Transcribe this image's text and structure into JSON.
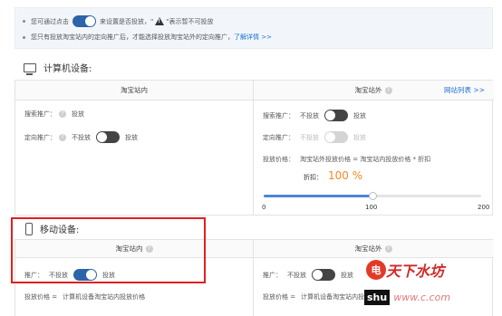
{
  "notice": {
    "line1_prefix": "您可通过点击",
    "line1_mid": "来设置是否投放，\"",
    "line1_suffix": "\"表示暂不可投放",
    "line2_text": "您只有投放淘宝站内的定向推广后，才能选择投放淘宝站外的定向推广，",
    "line2_link": "了解详情 >>"
  },
  "computer": {
    "title": "计算机设备:",
    "inside_header": "淘宝站内",
    "outside_header": "淘宝站外",
    "site_list_link": "网站列表 >>",
    "inside": {
      "search_label": "搜索推广：",
      "search_value": "投放",
      "targeted_label": "定向推广：",
      "targeted_off": "不投放",
      "targeted_on": "投放"
    },
    "outside": {
      "search_label": "搜索推广：",
      "search_off": "不投放",
      "search_on": "投放",
      "targeted_label": "定向推广：",
      "targeted_off": "不投放",
      "targeted_on": "投放",
      "price_label": "投放价格：",
      "price_formula": "淘宝站外投放价格 = 淘宝站内投放价格 * 折扣",
      "discount_label": "折扣：",
      "discount_value": "100 %",
      "slider_value": 100,
      "slider_min": "0",
      "slider_mid": "100",
      "slider_max": "200"
    }
  },
  "mobile": {
    "title": "移动设备:",
    "inside_header": "淘宝站内",
    "outside_header": "淘宝站外",
    "inside": {
      "promo_label": "推广：",
      "promo_off": "不投放",
      "promo_on": "投放",
      "price_label": "投放价格 =",
      "price_formula": "计算机设备淘宝站内投放价格"
    },
    "outside": {
      "promo_label": "推广：",
      "promo_off": "不投放",
      "promo_on": "投放",
      "price_label": "投放价格 =",
      "price_formula": "计算机设备淘宝站内投放价格"
    }
  },
  "watermark": {
    "circle": "电",
    "text": "天下水坊",
    "badge": "shu",
    "site": "www.c.com"
  },
  "colors": {
    "toggle_on": "#2b64a8",
    "toggle_off": "#444444",
    "highlight_box": "#e02020",
    "discount": "#f08a24",
    "link": "#1a6fd4"
  }
}
